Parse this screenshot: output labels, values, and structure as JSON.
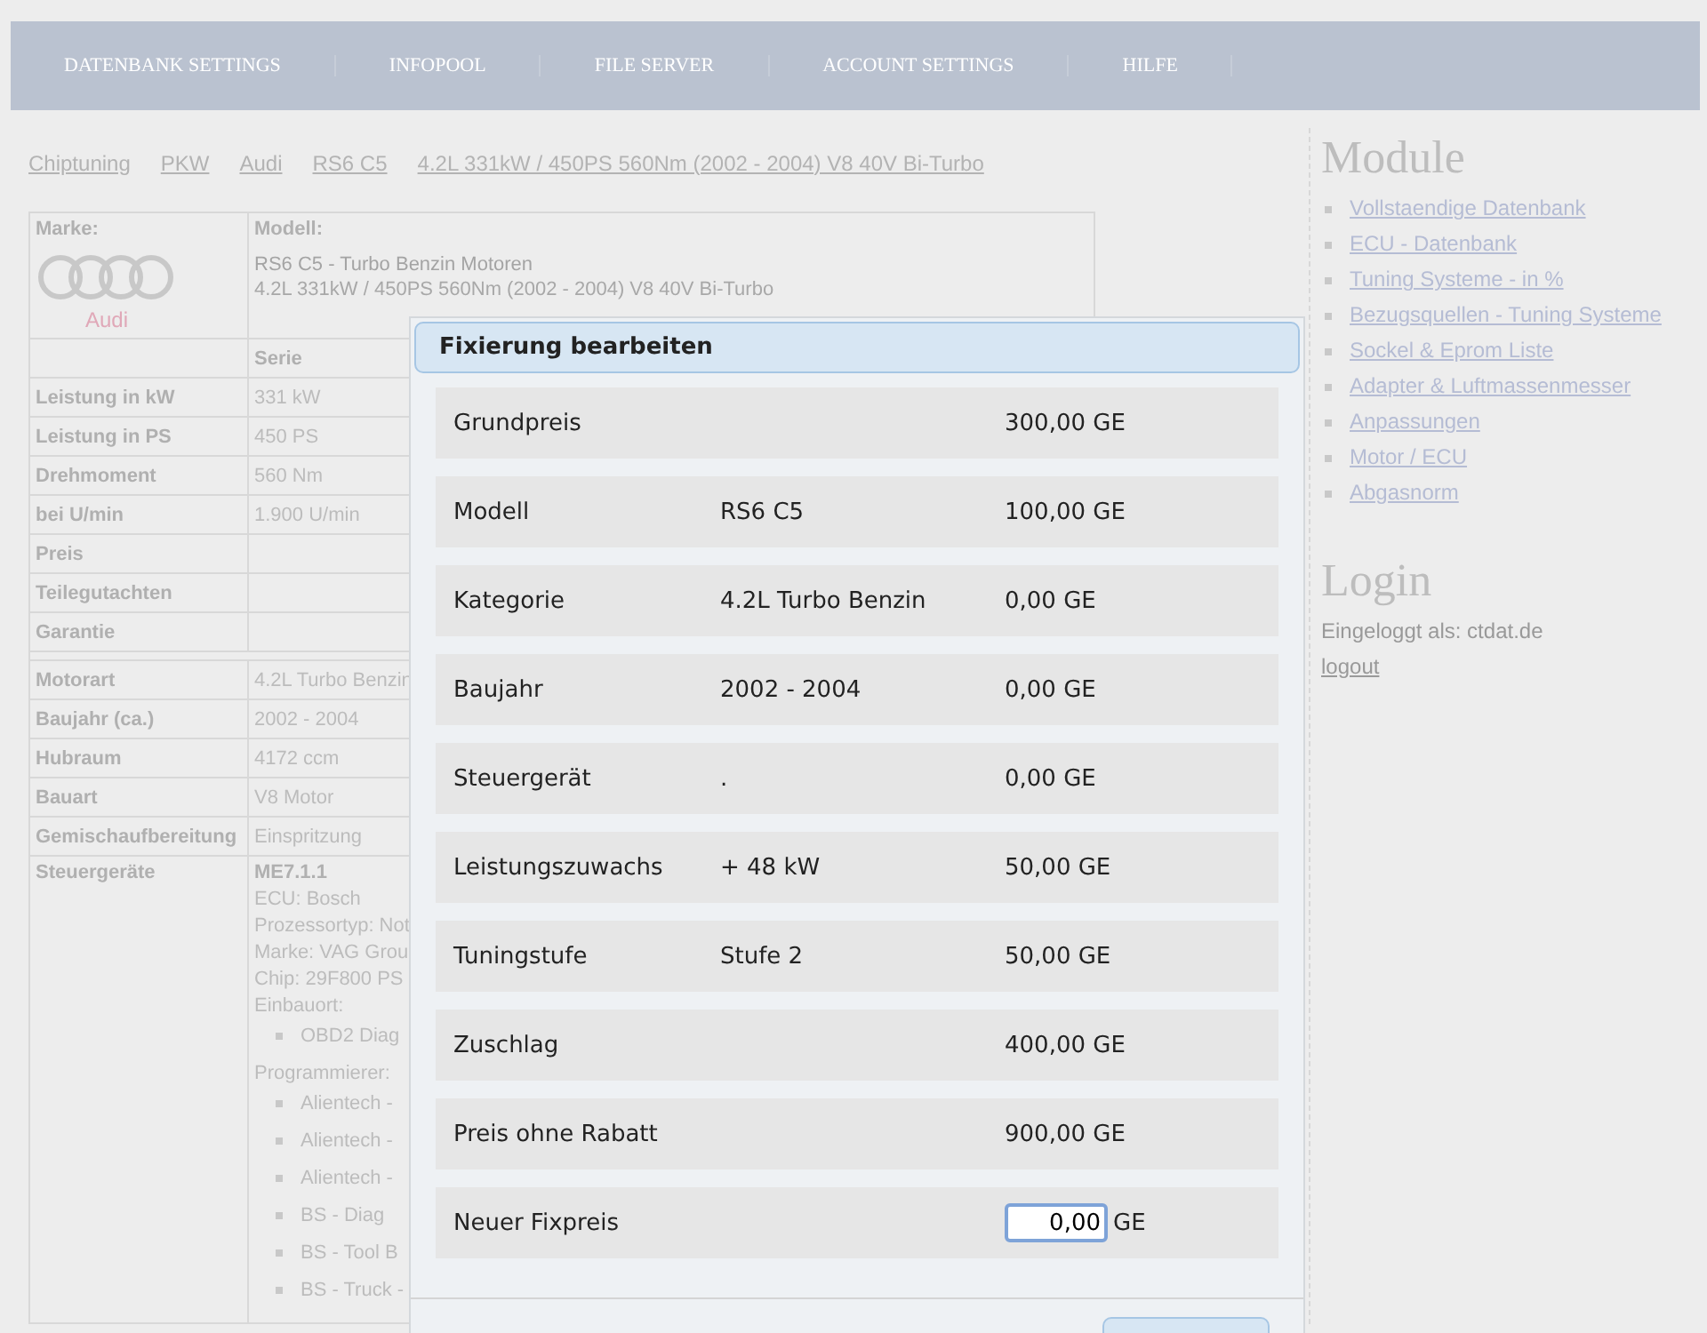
{
  "nav": [
    "DATENBANK SETTINGS",
    "INFOPOOL",
    "FILE SERVER",
    "ACCOUNT SETTINGS",
    "HILFE"
  ],
  "breadcrumb": [
    "Chiptuning",
    "PKW",
    "Audi",
    "RS6 C5",
    "4.2L 331kW / 450PS 560Nm (2002 - 2004) V8 40V Bi-Turbo"
  ],
  "vehicle": {
    "brand_label": "Marke:",
    "brand": "Audi",
    "model_label": "Modell:",
    "model_sub": "RS6 C5 - Turbo Benzin Motoren",
    "model": "4.2L 331kW / 450PS 560Nm (2002 - 2004) V8 40V Bi-Turbo",
    "column_header": "Serie",
    "rows": [
      {
        "label": "Leistung in kW",
        "value": "331 kW"
      },
      {
        "label": "Leistung in PS",
        "value": "450 PS"
      },
      {
        "label": "Drehmoment",
        "value": "560 Nm"
      },
      {
        "label": "bei U/min",
        "value": "1.900 U/min"
      },
      {
        "label": "Preis",
        "value": ""
      },
      {
        "label": "Teilegutachten",
        "value": ""
      },
      {
        "label": "Garantie",
        "value": ""
      }
    ],
    "rows2": [
      {
        "label": "Motorart",
        "value": "4.2L Turbo Benzin"
      },
      {
        "label": "Baujahr (ca.)",
        "value": "2002 - 2004"
      },
      {
        "label": "Hubraum",
        "value": "4172 ccm"
      },
      {
        "label": "Bauart",
        "value": "V8 Motor"
      },
      {
        "label": "Gemischaufbereitung",
        "value": "Einspritzung"
      }
    ],
    "ecu_label": "Steuergeräte",
    "ecu_name": "ME7.1.1",
    "ecu_lines": [
      "ECU: Bosch",
      "Prozessortyp: Not",
      "Marke: VAG Grou",
      "Chip: 29F800 PS",
      "Einbauort:"
    ],
    "einbauort": [
      "OBD2 Diag"
    ],
    "programmer_label": "Programmierer:",
    "programmers": [
      "Alientech -",
      "Alientech -",
      "Alientech -",
      "BS - Diag",
      "BS - Tool B",
      "BS - Truck -"
    ]
  },
  "sidebar": {
    "title": "Module",
    "links": [
      "Vollstaendige Datenbank",
      "ECU - Datenbank",
      "Tuning Systeme - in %",
      "Bezugsquellen - Tuning Systeme",
      "Sockel & Eprom Liste",
      "Adapter & Luftmassenmesser",
      "Anpassungen",
      "Motor / ECU",
      "Abgasnorm"
    ],
    "login_title": "Login",
    "login_text": "Eingeloggt als: ctdat.de",
    "logout": "logout"
  },
  "dialog": {
    "title": "Fixierung bearbeiten",
    "rows": [
      {
        "label": "Grundpreis",
        "detail": "",
        "price": "300,00 GE"
      },
      {
        "label": "Modell",
        "detail": "RS6 C5",
        "price": "100,00 GE"
      },
      {
        "label": "Kategorie",
        "detail": "4.2L Turbo Benzin",
        "price": "0,00 GE"
      },
      {
        "label": "Baujahr",
        "detail": "2002 - 2004",
        "price": "0,00 GE"
      },
      {
        "label": "Steuergerät",
        "detail": ".",
        "price": "0,00 GE"
      },
      {
        "label": "Leistungszuwachs",
        "detail": "+ 48 kW",
        "price": "50,00 GE"
      },
      {
        "label": "Tuningstufe",
        "detail": "Stufe 2",
        "price": "50,00 GE"
      },
      {
        "label": "Zuschlag",
        "detail": "",
        "price": "400,00 GE"
      },
      {
        "label": "Preis ohne Rabatt",
        "detail": "",
        "price": "900,00 GE"
      }
    ],
    "input_label": "Neuer Fixpreis",
    "input_value": "0,00",
    "input_unit": "GE"
  }
}
